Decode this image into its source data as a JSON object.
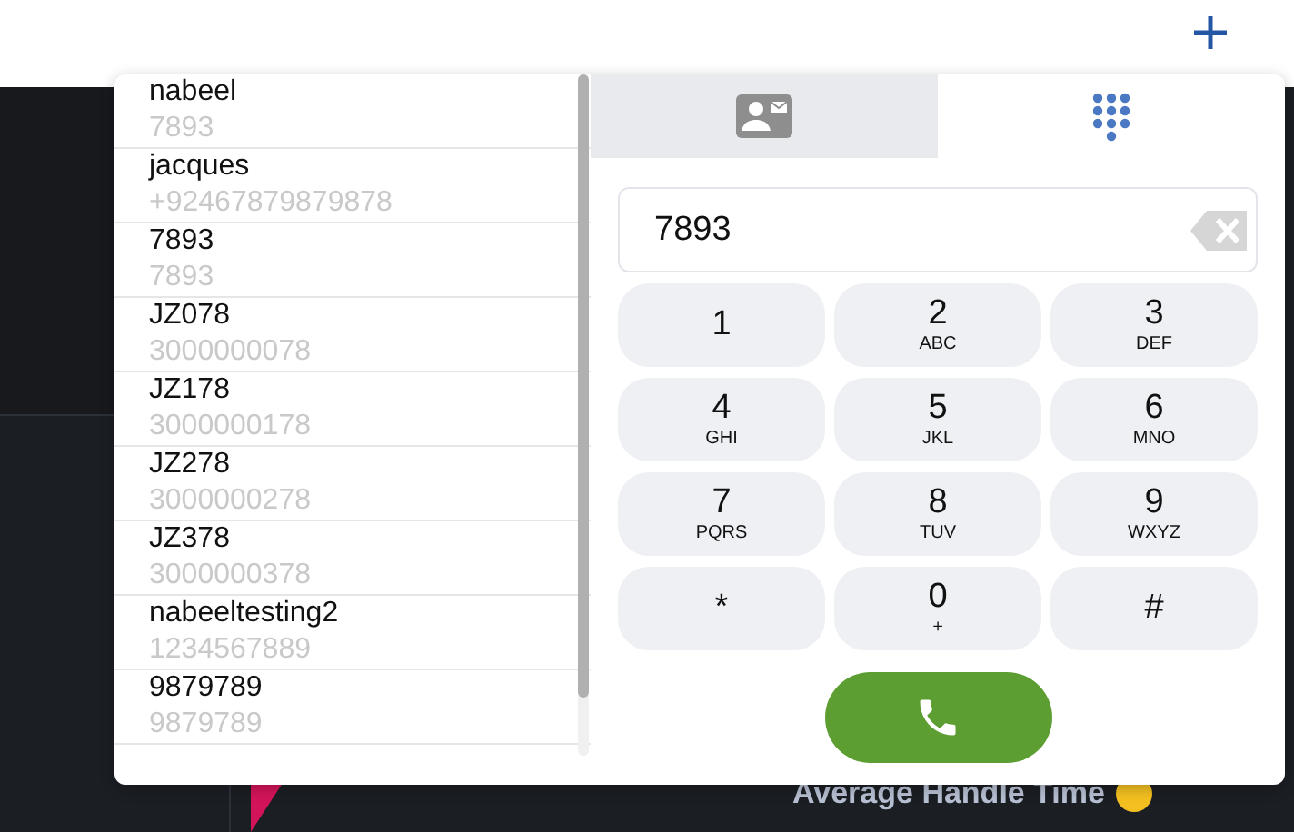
{
  "metric": {
    "label": "Average Handle Time"
  },
  "contacts": [
    {
      "name": "nabeel",
      "number": "7893"
    },
    {
      "name": "jacques",
      "number": "+92467879879878"
    },
    {
      "name": "7893",
      "number": "7893"
    },
    {
      "name": "JZ078",
      "number": "3000000078"
    },
    {
      "name": "JZ178",
      "number": "3000000178"
    },
    {
      "name": "JZ278",
      "number": "3000000278"
    },
    {
      "name": "JZ378",
      "number": "3000000378"
    },
    {
      "name": "nabeeltesting2",
      "number": "1234567889"
    },
    {
      "name": "9879789",
      "number": "9879789"
    }
  ],
  "tabs": [
    {
      "kind": "contacts",
      "selected": false
    },
    {
      "kind": "dialpad",
      "selected": true
    }
  ],
  "dial_input": {
    "value": "7893"
  },
  "keys": [
    {
      "digit": "1"
    },
    {
      "digit": "2",
      "letters": "ABC"
    },
    {
      "digit": "3",
      "letters": "DEF"
    },
    {
      "digit": "4",
      "letters": "GHI"
    },
    {
      "digit": "5",
      "letters": "JKL"
    },
    {
      "digit": "6",
      "letters": "MNO"
    },
    {
      "digit": "7",
      "letters": "PQRS"
    },
    {
      "digit": "8",
      "letters": "TUV"
    },
    {
      "digit": "9",
      "letters": "WXYZ"
    },
    {
      "digit": "*"
    },
    {
      "digit": "0",
      "letters": "+"
    },
    {
      "digit": "#"
    }
  ]
}
